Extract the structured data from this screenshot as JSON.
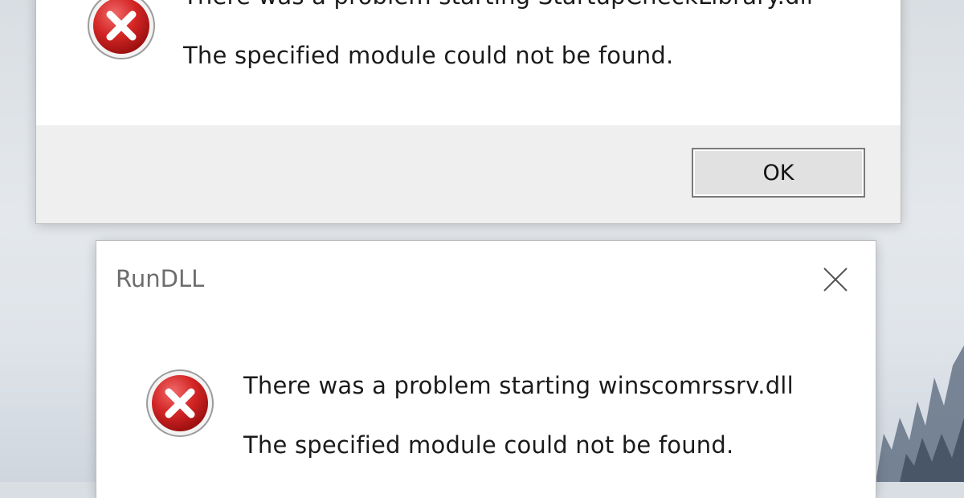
{
  "dialog_top": {
    "line1": "There was a problem starting StartupCheckLibrary.dll",
    "line2": "The specified module could not be found.",
    "ok_label": "OK",
    "icon": "error-icon"
  },
  "dialog_bottom": {
    "title": "RunDLL",
    "line1": "There was a problem starting winscomrssrv.dll",
    "line2": "The specified module could not be found.",
    "icon": "error-icon",
    "close_icon": "close-icon"
  },
  "colors": {
    "error_red": "#c42b1c",
    "dialog_bg": "#ffffff",
    "footer_bg": "#efefef"
  }
}
